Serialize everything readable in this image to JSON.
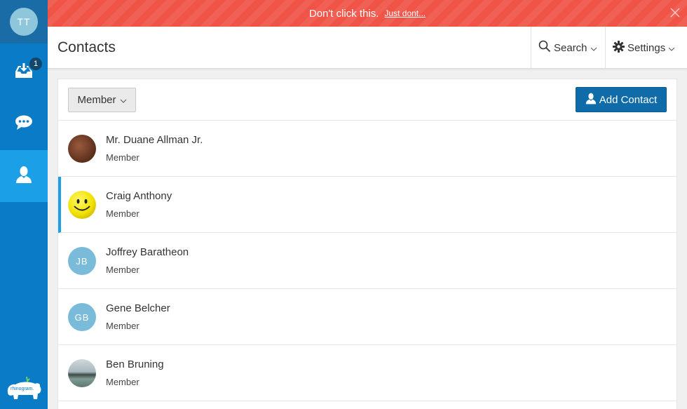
{
  "sidebar": {
    "user_initials": "TT",
    "inbox_badge": "1",
    "items": [
      {
        "icon": "inbox-download-icon"
      },
      {
        "icon": "chat-bubble-icon"
      },
      {
        "icon": "user-icon"
      }
    ],
    "logo_text": "rhinogram."
  },
  "banner": {
    "message": "Don't click this.",
    "link_text": "Just dont...",
    "color": "#ef5447"
  },
  "header": {
    "title": "Contacts",
    "search_label": "Search",
    "settings_label": "Settings"
  },
  "toolbar": {
    "filter_label": "Member",
    "add_contact_label": "Add Contact",
    "accent": "#0f6ca9"
  },
  "contacts": [
    {
      "name": "Mr. Duane Allman Jr.",
      "role": "Member",
      "avatar": "photo"
    },
    {
      "name": "Craig Anthony",
      "role": "Member",
      "avatar": "smiley"
    },
    {
      "name": "Joffrey Baratheon",
      "role": "Member",
      "initials": "JB"
    },
    {
      "name": "Gene Belcher",
      "role": "Member",
      "initials": "GB"
    },
    {
      "name": "Ben Bruning",
      "role": "Member",
      "avatar": "photo"
    }
  ]
}
